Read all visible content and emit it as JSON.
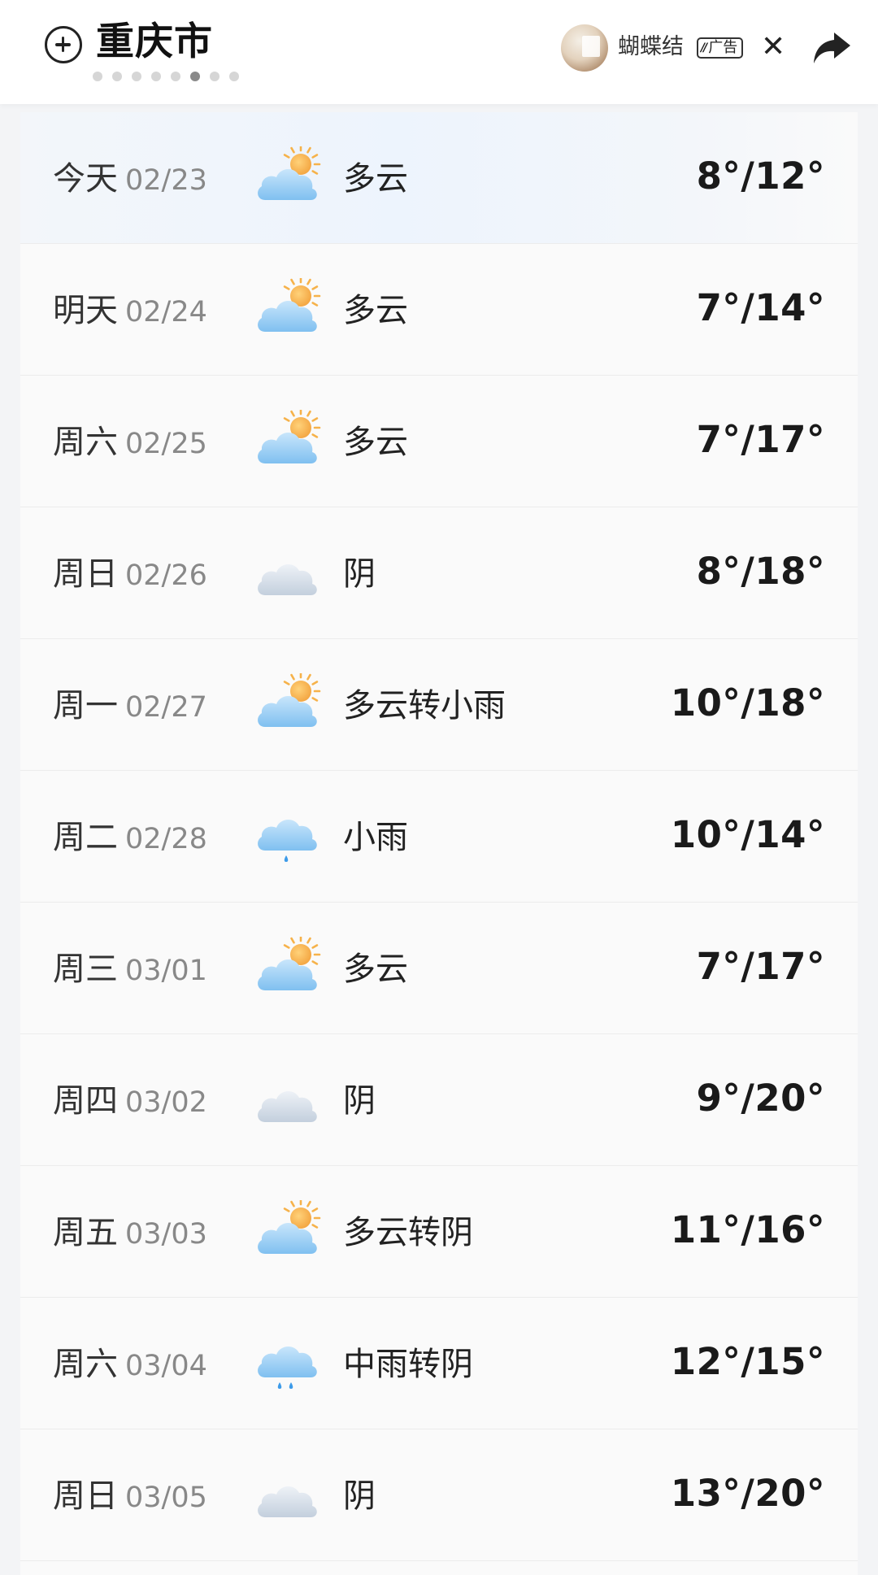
{
  "header": {
    "city": "重庆市",
    "page_count": 8,
    "active_page": 6,
    "ad": {
      "title": "蝴蝶结",
      "badge": "广告",
      "badge_mark": "//"
    },
    "close_symbol": "✕",
    "icons": {
      "add": "add-city-icon",
      "share": "share-icon",
      "close": "close-icon"
    }
  },
  "forecast": [
    {
      "day": "今天",
      "date": "02/23",
      "condition": "多云",
      "icon": "partly-cloudy",
      "temp": "8°/12°",
      "highlight": true
    },
    {
      "day": "明天",
      "date": "02/24",
      "condition": "多云",
      "icon": "partly-cloudy",
      "temp": "7°/14°"
    },
    {
      "day": "周六",
      "date": "02/25",
      "condition": "多云",
      "icon": "partly-cloudy",
      "temp": "7°/17°"
    },
    {
      "day": "周日",
      "date": "02/26",
      "condition": "阴",
      "icon": "overcast",
      "temp": "8°/18°"
    },
    {
      "day": "周一",
      "date": "02/27",
      "condition": "多云转小雨",
      "icon": "partly-cloudy",
      "temp": "10°/18°"
    },
    {
      "day": "周二",
      "date": "02/28",
      "condition": "小雨",
      "icon": "light-rain",
      "temp": "10°/14°"
    },
    {
      "day": "周三",
      "date": "03/01",
      "condition": "多云",
      "icon": "partly-cloudy",
      "temp": "7°/17°"
    },
    {
      "day": "周四",
      "date": "03/02",
      "condition": "阴",
      "icon": "overcast",
      "temp": "9°/20°"
    },
    {
      "day": "周五",
      "date": "03/03",
      "condition": "多云转阴",
      "icon": "partly-cloudy",
      "temp": "11°/16°"
    },
    {
      "day": "周六",
      "date": "03/04",
      "condition": "中雨转阴",
      "icon": "moderate-rain",
      "temp": "12°/15°"
    },
    {
      "day": "周日",
      "date": "03/05",
      "condition": "阴",
      "icon": "overcast",
      "temp": "13°/20°"
    }
  ],
  "colors": {
    "sun": "#f6b24a",
    "cloud_blue": "#8fc9f4",
    "cloud_grey": "#cfd9e6",
    "rain": "#3d9be9",
    "today_highlight": "#edf4fd"
  }
}
